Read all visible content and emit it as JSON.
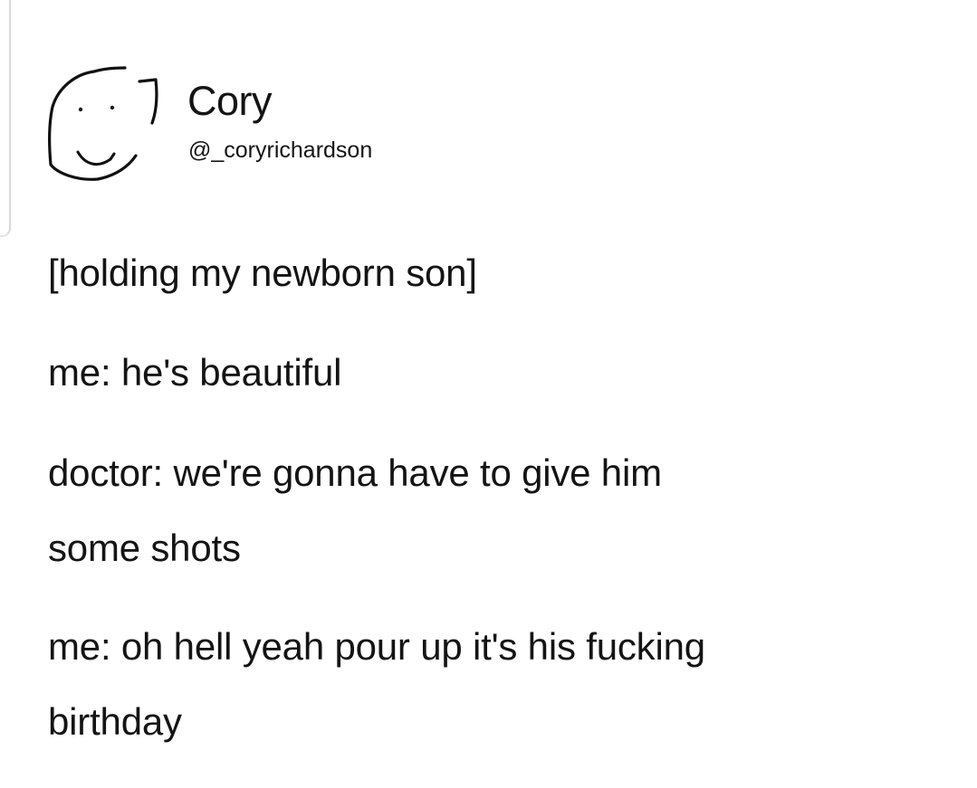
{
  "user": {
    "display_name": "Cory",
    "handle": "@_coryrichardson",
    "avatar_icon": "hand-drawn-smiley-icon"
  },
  "tweet": {
    "lines": [
      "[holding my newborn son]",
      "me: he's beautiful",
      "doctor: we're gonna have to give him",
      "some shots",
      "me: oh hell yeah pour up it's his fucking",
      "birthday"
    ]
  }
}
